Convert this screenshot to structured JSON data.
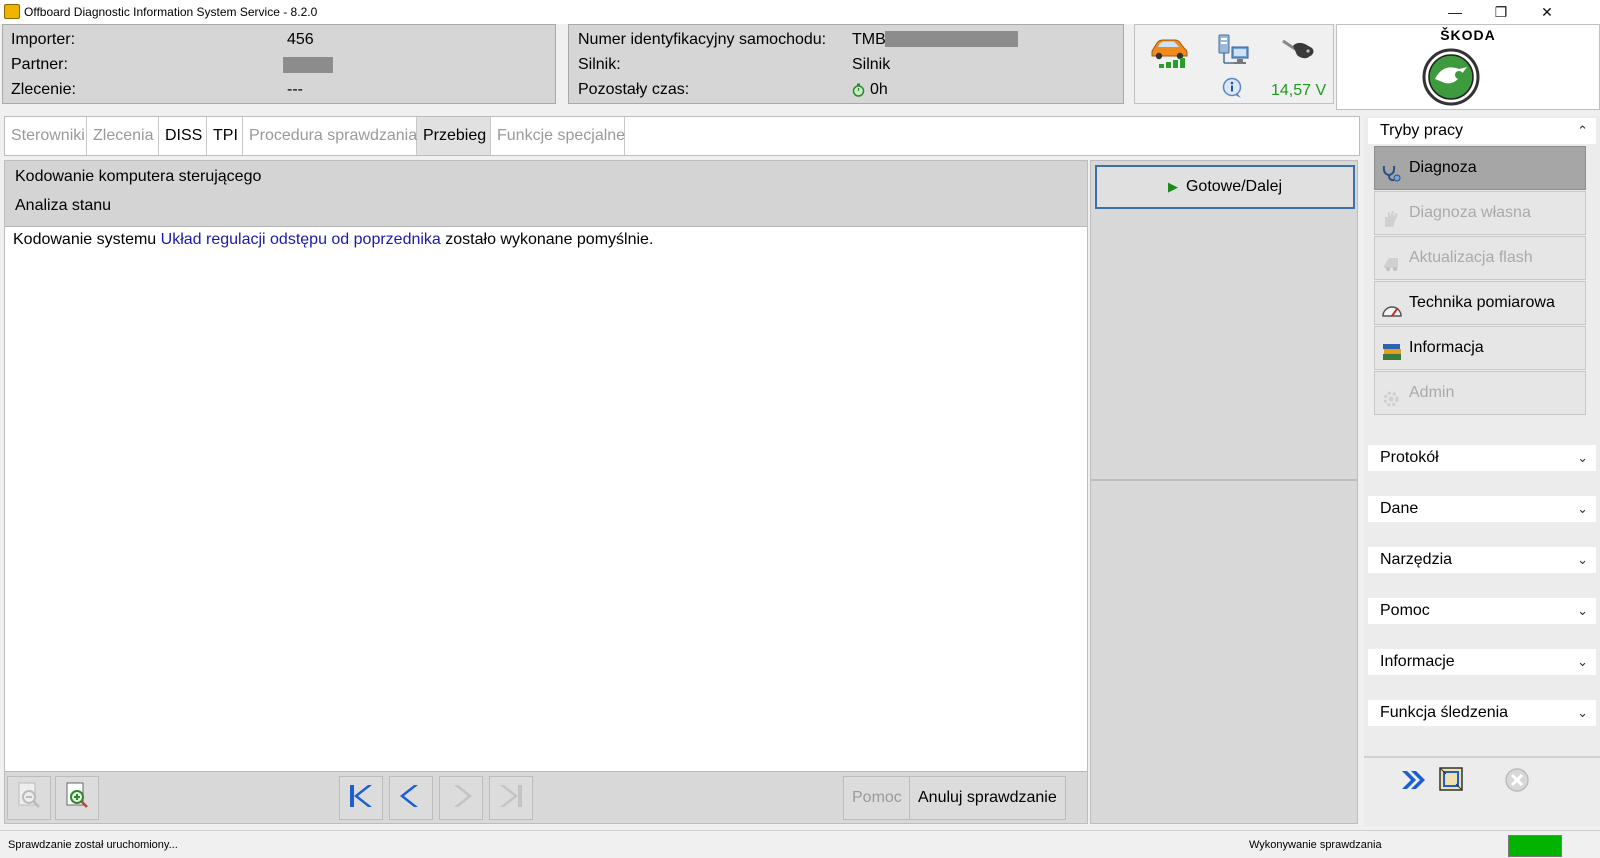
{
  "window": {
    "title": "Offboard Diagnostic Information System Service - 8.2.0",
    "min": "—",
    "max": "❐",
    "close": "✕"
  },
  "header": {
    "importer_label": "Importer:",
    "importer_value": "456",
    "partner_label": "Partner:",
    "zlecenie_label": "Zlecenie:",
    "zlecenie_value": "---",
    "vin_label": "Numer identyfikacyjny samochodu:",
    "vin_value": "TMB",
    "silnik_label": "Silnik:",
    "silnik_value": "Silnik",
    "czas_label": "Pozostały czas:",
    "czas_value": "0h",
    "voltage": "14,57 V",
    "brand": "ŠKODA"
  },
  "tabs": [
    {
      "label": "Sterowniki",
      "state": "disabled"
    },
    {
      "label": "Zlecenia",
      "state": "disabled"
    },
    {
      "label": "DISS",
      "state": "enabled"
    },
    {
      "label": "TPI",
      "state": "enabled"
    },
    {
      "label": "Procedura sprawdzania",
      "state": "disabled"
    },
    {
      "label": "Przebieg",
      "state": "active"
    },
    {
      "label": "Funkcje specjalne",
      "state": "disabled"
    }
  ],
  "main": {
    "heading1": "Kodowanie komputera sterującego",
    "heading2": "Analiza stanu",
    "msg_before": "Kodowanie systemu ",
    "msg_link": "Układ regulacji odstępu od poprzednika",
    "msg_after": " zostało wykonane pomyślnie.",
    "help_label": "Pomoc",
    "cancel_label": "Anuluj sprawdzanie"
  },
  "actions": {
    "next_label": "Gotowe/Dalej"
  },
  "sidebar": {
    "modes_title": "Tryby pracy",
    "modes": [
      {
        "label": "Diagnoza",
        "state": "active",
        "icon": "stethoscope-icon"
      },
      {
        "label": "Diagnoza własna",
        "state": "disabled",
        "icon": "hand-icon"
      },
      {
        "label": "Aktualizacja flash",
        "state": "disabled",
        "icon": "flash-icon"
      },
      {
        "label": "Technika pomiarowa",
        "state": "enabled",
        "icon": "gauge-icon"
      },
      {
        "label": "Informacja",
        "state": "enabled",
        "icon": "books-icon"
      },
      {
        "label": "Admin",
        "state": "disabled",
        "icon": "gear-icon"
      }
    ],
    "sections": [
      "Protokół",
      "Dane",
      "Narzędzia",
      "Pomoc",
      "Informacje",
      "Funkcja śledzenia"
    ]
  },
  "status": {
    "left": "Sprawdzanie został uruchomiony...",
    "right": "Wykonywanie sprawdzania",
    "indicator_color": "#00b400"
  },
  "colors": {
    "link": "#1a1ab0",
    "voltage": "#1f9a1f",
    "accent_blue": "#1b5fd0"
  }
}
